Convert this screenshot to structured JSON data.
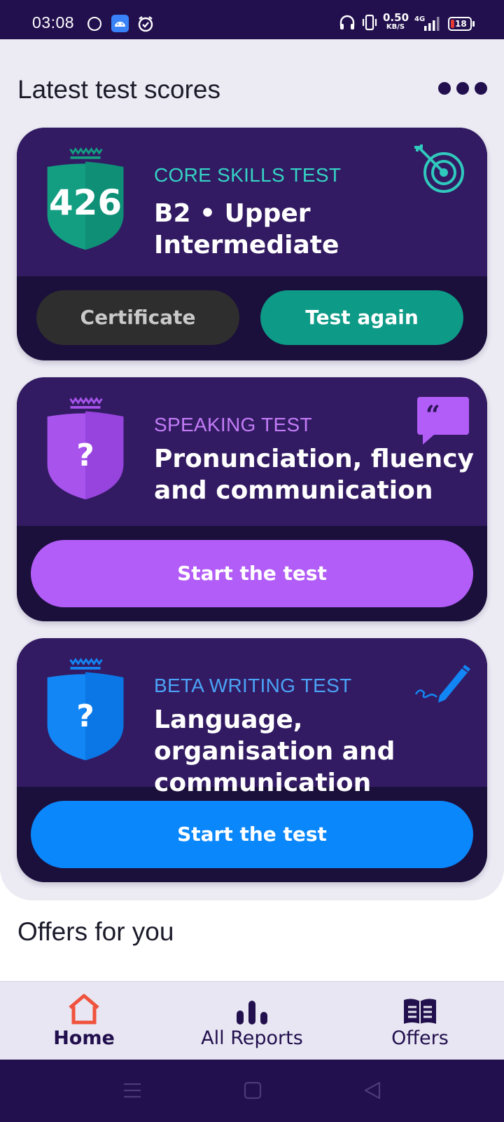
{
  "status_bar": {
    "time": "03:08",
    "net_speed_value": "0.50",
    "net_speed_unit": "KB/S",
    "network": "4G",
    "battery": "18",
    "icons": [
      "moon-icon",
      "android-app-icon",
      "alarm-check-icon",
      "headphones-icon",
      "vibrate-icon",
      "signal-icon",
      "battery-icon"
    ]
  },
  "scores": {
    "title": "Latest test scores",
    "menu_icon": "more-dots-icon"
  },
  "cards": [
    {
      "label": "CORE SKILLS TEST",
      "title": "B2 • Upper Intermediate",
      "score": "426",
      "shield_color": "#139e82",
      "label_color": "#35d3c4",
      "deco_icon": "target-icon",
      "buttons": {
        "certificate": "Certificate",
        "test_again": "Test again"
      }
    },
    {
      "label": "SPEAKING TEST",
      "title": "Pronunciation, fluency and communication",
      "score": "?",
      "shield_color": "#a753ec",
      "label_color": "#c27cf7",
      "deco_icon": "speech-quote-icon",
      "button": "Start the test",
      "button_color": "#b25df7"
    },
    {
      "label": "BETA WRITING TEST",
      "title": "Language, organisation and communication",
      "score": "?",
      "shield_color": "#1386f5",
      "label_color": "#4ba3f7",
      "deco_icon": "pen-icon",
      "button": "Start the test",
      "button_color": "#0a87fb"
    }
  ],
  "offers": {
    "title": "Offers for you"
  },
  "bottom_nav": [
    {
      "label": "Home",
      "icon": "home-icon",
      "active": true
    },
    {
      "label": "All Reports",
      "icon": "bar-chart-icon",
      "active": false
    },
    {
      "label": "Offers",
      "icon": "open-book-icon",
      "active": false
    }
  ],
  "system_nav": [
    "menu-icon",
    "home-square-icon",
    "back-triangle-icon"
  ],
  "colors": {
    "brand_dark": "#22104e",
    "card_top": "#321b62",
    "card_bottom": "#1b0f3b",
    "teal": "#0d9a86",
    "home_active": "#f0533d"
  }
}
